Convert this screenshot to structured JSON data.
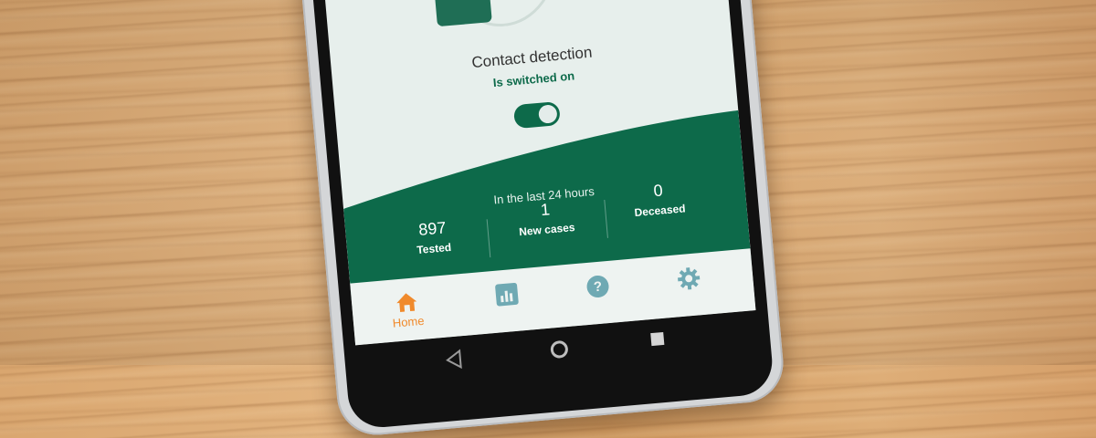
{
  "app": {
    "contact_detection": {
      "title": "Contact detection",
      "status": "Is switched on",
      "toggle_on": true
    },
    "stats": {
      "heading": "In the last 24 hours",
      "items": [
        {
          "value": "897",
          "label": "Tested"
        },
        {
          "value": "1",
          "label": "New cases"
        },
        {
          "value": "0",
          "label": "Deceased"
        }
      ]
    },
    "bottom_nav": {
      "items": [
        {
          "label": "Home",
          "icon": "home-icon",
          "active": true
        },
        {
          "label": "",
          "icon": "statistics-icon",
          "active": false
        },
        {
          "label": "",
          "icon": "help-icon",
          "active": false
        },
        {
          "label": "",
          "icon": "gear-icon",
          "active": false
        }
      ]
    }
  },
  "colors": {
    "brand_green": "#0d6a4a",
    "active_nav": "#f08a2c",
    "inactive_nav": "#6fa9b3",
    "screen_background": "#e7efec"
  }
}
